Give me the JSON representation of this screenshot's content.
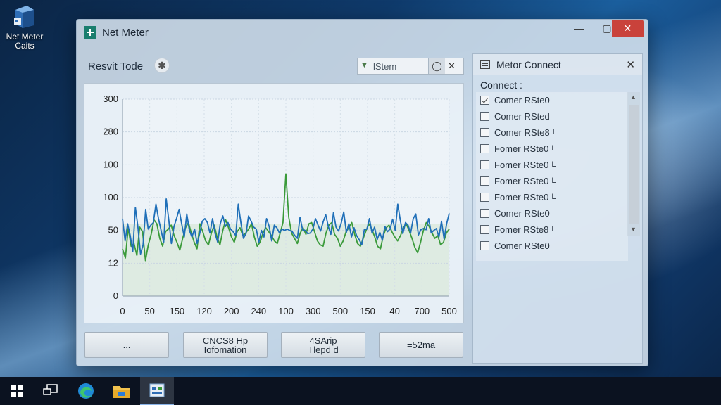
{
  "desktop": {
    "icon_label": "Net Meter Caits"
  },
  "window": {
    "title": "Net Meter",
    "min_label": "—",
    "max_label": "▢",
    "close_label": "✕"
  },
  "toolbar": {
    "label": "Resvit Tode",
    "gear_label": "✱",
    "search_value": "lStem",
    "search_button": "◯",
    "search_clear": "✕"
  },
  "buttons": [
    {
      "line1": "...",
      "line2": ""
    },
    {
      "line1": "CNCS8 Hp",
      "line2": "Iofomation"
    },
    {
      "line1": "4SArip",
      "line2": "Tlepd d"
    },
    {
      "line1": "=52ma",
      "line2": ""
    }
  ],
  "side_panel": {
    "title": "Metor Connect",
    "close_label": "✕",
    "subtitle": "Connect :",
    "items": [
      {
        "label": "Comer RSte0",
        "checked": true,
        "suffix": ""
      },
      {
        "label": "Comer RSted",
        "checked": false,
        "suffix": ""
      },
      {
        "label": "Comer RSte8",
        "checked": false,
        "suffix": "L"
      },
      {
        "label": "Fomer RSte0",
        "checked": false,
        "suffix": "L"
      },
      {
        "label": "Fomer RSte0",
        "checked": false,
        "suffix": "L"
      },
      {
        "label": "Fomer RSte0",
        "checked": false,
        "suffix": "L"
      },
      {
        "label": "Fomer RSte0",
        "checked": false,
        "suffix": "L"
      },
      {
        "label": "Comer RSte0",
        "checked": false,
        "suffix": ""
      },
      {
        "label": "Fomer RSte8",
        "checked": false,
        "suffix": "L"
      },
      {
        "label": "Comer RSte0",
        "checked": false,
        "suffix": ""
      }
    ]
  },
  "taskbar": {
    "icons": [
      "windows-start-icon",
      "task-view-icon",
      "edge-icon",
      "file-explorer-icon",
      "net-meter-taskbar-icon"
    ]
  },
  "colors": {
    "series_blue": "#1f6fb8",
    "series_green": "#3a9a3a",
    "close_red": "#c9423b"
  },
  "chart_data": {
    "type": "line",
    "y_tick_labels": [
      "300",
      "280",
      "100",
      "100",
      "50",
      "12",
      "0"
    ],
    "x_tick_labels": [
      "0",
      "50",
      "150",
      "120",
      "200",
      "240",
      "100",
      "300",
      "500",
      "150",
      "40",
      "700",
      "500"
    ],
    "ylim": [
      0,
      300
    ],
    "grid": true,
    "series": [
      {
        "color": "#1f6fb8",
        "values": [
          118,
          84,
          110,
          92,
          68,
          135,
          105,
          64,
          78,
          132,
          102,
          108,
          112,
          140,
          118,
          100,
          82,
          148,
          115,
          80,
          106,
          118,
          132,
          110,
          90,
          125,
          100,
          90,
          102,
          80,
          95,
          114,
          118,
          112,
          96,
          118,
          95,
          82,
          110,
          122,
          106,
          112,
          102,
          98,
          92,
          140,
          112,
          88,
          95,
          122,
          114,
          105,
          102,
          82,
          100,
          90,
          118,
          106,
          84,
          108,
          104,
          96,
          102,
          100,
          102,
          100,
          98,
          92,
          88,
          120,
          101,
          100,
          95,
          96,
          102,
          118,
          108,
          99,
          113,
          124,
          106,
          94,
          127,
          105,
          99,
          111,
          128,
          97,
          110,
          90,
          104,
          92,
          86,
          78,
          101,
          102,
          118,
          96,
          105,
          86,
          97,
          85,
          106,
          98,
          102,
          117,
          100,
          140,
          115,
          95,
          112,
          108,
          96,
          118,
          125,
          93,
          101,
          103,
          101,
          118,
          96,
          100,
          103,
          90,
          114,
          87,
          110,
          126
        ]
      },
      {
        "color": "#3a9a3a",
        "values": [
          72,
          58,
          104,
          76,
          80,
          62,
          105,
          98,
          54,
          78,
          94,
          116,
          110,
          88,
          76,
          98,
          102,
          108,
          92,
          82,
          70,
          88,
          104,
          112,
          96,
          82,
          72,
          110,
          98,
          84,
          78,
          96,
          108,
          90,
          78,
          100,
          116,
          104,
          90,
          82,
          98,
          104,
          92,
          96,
          102,
          110,
          90,
          76,
          82,
          96,
          104,
          98,
          92,
          84,
          80,
          96,
          112,
          186,
          120,
          96,
          88,
          80,
          96,
          104,
          94,
          110,
          112,
          98,
          84,
          78,
          76,
          96,
          108,
          112,
          94,
          88,
          76,
          84,
          98,
          104,
          112,
          94,
          80,
          76,
          88,
          100,
          110,
          102,
          90,
          76,
          72,
          92,
          104,
          108,
          98,
          90,
          84,
          92,
          104,
          110,
          100,
          88,
          74,
          66,
          82,
          100,
          112,
          106,
          96,
          88,
          92,
          78,
          82,
          96,
          102
        ]
      }
    ]
  }
}
